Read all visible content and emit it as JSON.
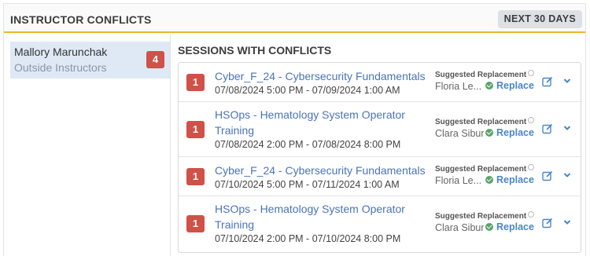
{
  "header": {
    "title": "INSTRUCTOR CONFLICTS",
    "range_label": "NEXT 30 DAYS"
  },
  "instructor": {
    "name": "Mallory Marunchak",
    "group": "Outside Instructors",
    "conflict_count": "4"
  },
  "sessions": {
    "title": "SESSIONS WITH CONFLICTS",
    "suggested_label": "Suggested Replacement",
    "replace_label": "Replace",
    "rows": [
      {
        "count": "1",
        "title": "Cyber_F_24 - Cybersecurity Fundamentals",
        "time": "07/08/2024 5:00 PM - 07/09/2024 1:00 AM",
        "replacement": "Floria Le..."
      },
      {
        "count": "1",
        "title": "HSOps - Hematology System Operator Training",
        "time": "07/08/2024 2:00 PM - 07/08/2024 8:00 PM",
        "replacement": "Clara Sibun"
      },
      {
        "count": "1",
        "title": "Cyber_F_24 - Cybersecurity Fundamentals",
        "time": "07/10/2024 5:00 PM - 07/11/2024 1:00 AM",
        "replacement": "Floria Le..."
      },
      {
        "count": "1",
        "title": "HSOps - Hematology System Operator Training",
        "time": "07/10/2024 2:00 PM - 07/10/2024 8:00 PM",
        "replacement": "Clara Sibun"
      }
    ]
  },
  "colors": {
    "accent": "#f0b429",
    "badge": "#cf5148",
    "link": "#4a74b8",
    "selected": "#dfe9f5",
    "check": "#5aa469"
  },
  "icons": {
    "edit": "edit-icon",
    "expand": "chevron-down-icon",
    "info": "info-icon",
    "check": "check-circle-icon"
  }
}
